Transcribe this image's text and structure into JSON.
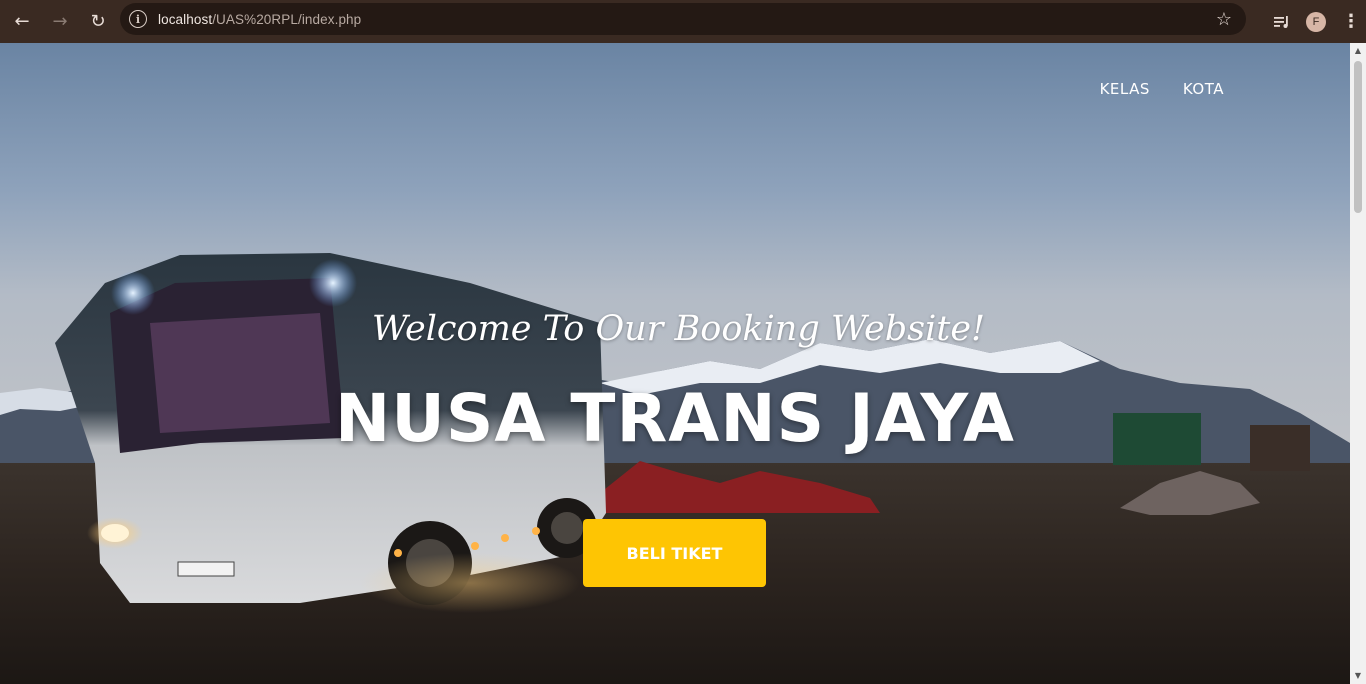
{
  "browser": {
    "back_icon": "←",
    "forward_icon": "→",
    "reload_icon": "↻",
    "url_host": "localhost",
    "url_path": "/UAS%20RPL/index.php",
    "bookmark_icon": "☆",
    "media_icon": "≡",
    "profile_initial": "F",
    "menu_icon": "⋮"
  },
  "nav": {
    "items": [
      {
        "label": "KELAS"
      },
      {
        "label": "KOTA"
      }
    ]
  },
  "hero": {
    "subtitle": "Welcome To Our Booking Website!",
    "title": "NUSA TRANS JAYA",
    "cta_label": "BELI TIKET"
  },
  "colors": {
    "cta": "#fec503",
    "chrome": "#3a2a22"
  }
}
